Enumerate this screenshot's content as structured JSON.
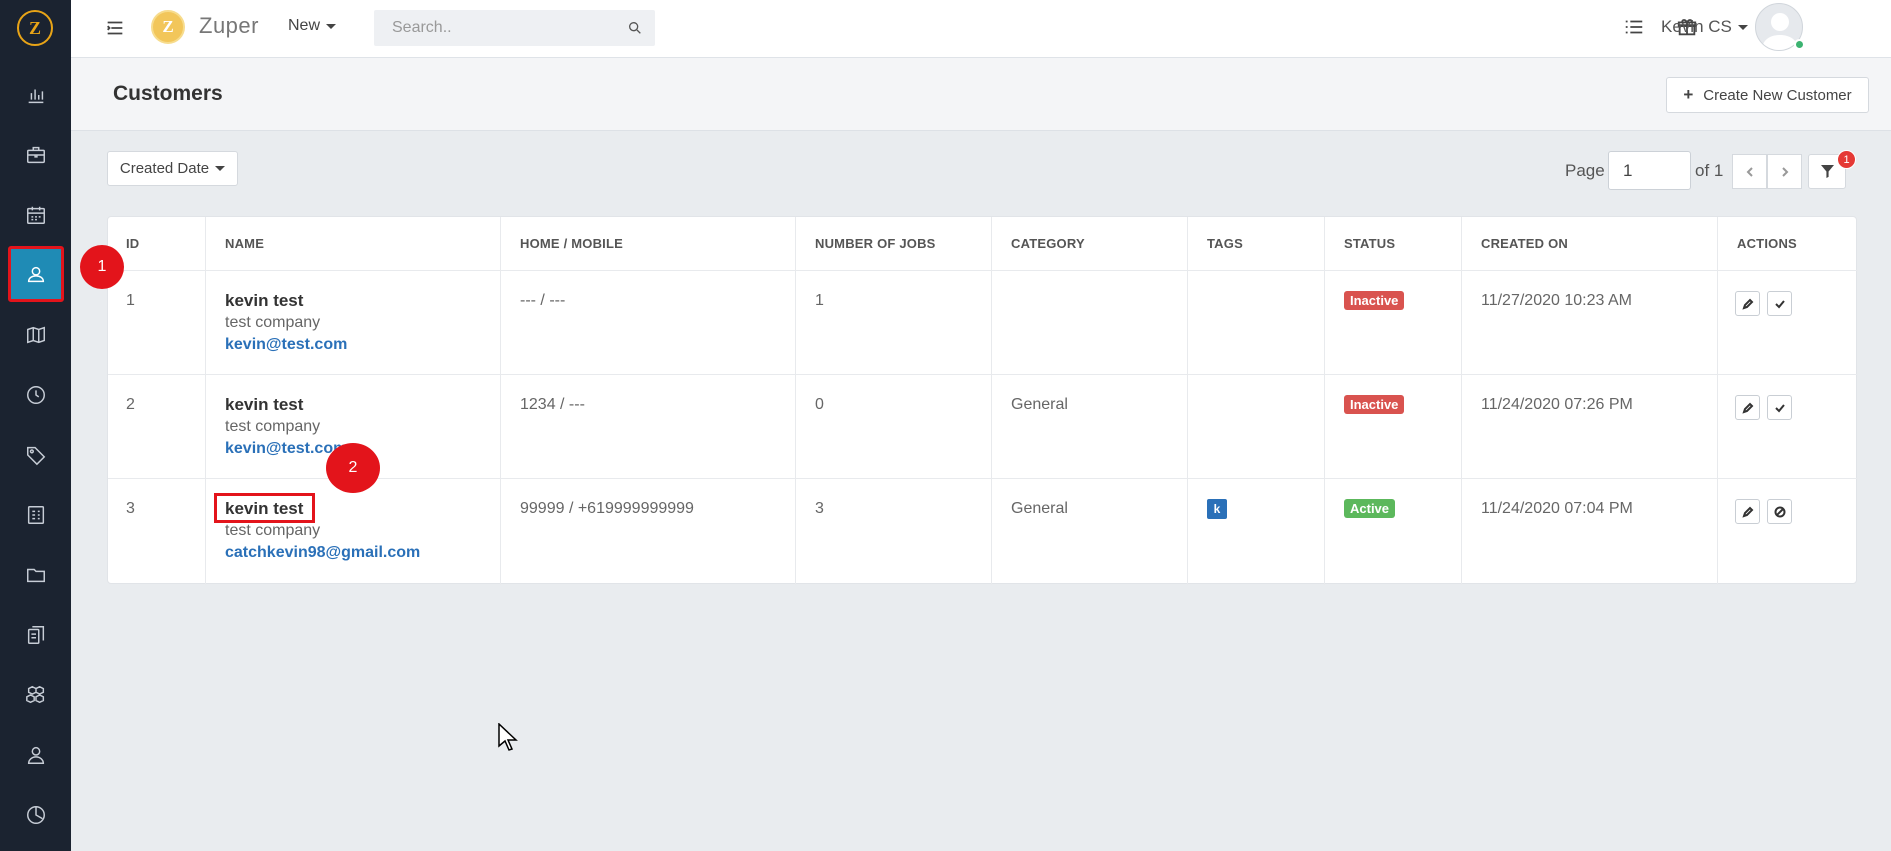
{
  "brand": {
    "logo_letter": "Z",
    "name": "Zuper"
  },
  "topbar": {
    "new_label": "New",
    "search_placeholder": "Search..",
    "user_name": "Kevin CS"
  },
  "sidebar": {
    "items": [
      {
        "icon": "dashboard-chart-icon"
      },
      {
        "icon": "briefcase-icon"
      },
      {
        "icon": "calendar-icon"
      },
      {
        "icon": "customers-icon",
        "active": true
      },
      {
        "icon": "map-icon"
      },
      {
        "icon": "clock-icon"
      },
      {
        "icon": "tag-icon"
      },
      {
        "icon": "invoice-icon"
      },
      {
        "icon": "folder-icon"
      },
      {
        "icon": "documents-icon"
      },
      {
        "icon": "boxes-icon"
      },
      {
        "icon": "user-icon"
      },
      {
        "icon": "reports-icon"
      }
    ]
  },
  "page": {
    "title": "Customers",
    "create_button": "Create New Customer",
    "sort_label": "Created Date",
    "pagination": {
      "label": "Page",
      "current": "1",
      "of_label": "of 1"
    },
    "filter_count": "1"
  },
  "table": {
    "headers": [
      "ID",
      "NAME",
      "HOME / MOBILE",
      "NUMBER OF JOBS",
      "CATEGORY",
      "TAGS",
      "STATUS",
      "CREATED ON",
      "ACTIONS"
    ],
    "rows": [
      {
        "id": "1",
        "name": "kevin test",
        "company": "test company",
        "email": "kevin@test.com",
        "phone": "--- / ---",
        "jobs": "1",
        "category": "",
        "tag": "",
        "status": "Inactive",
        "created": "11/27/2020 10:23 AM",
        "second_action": "check-icon"
      },
      {
        "id": "2",
        "name": "kevin test",
        "company": "test company",
        "email": "kevin@test.com",
        "phone": "1234 / ---",
        "jobs": "0",
        "category": "General",
        "tag": "",
        "status": "Inactive",
        "created": "11/24/2020 07:26 PM",
        "second_action": "check-icon"
      },
      {
        "id": "3",
        "name": "kevin test",
        "company": "test company",
        "email": "catchkevin98@gmail.com",
        "phone": "99999 / +619999999999",
        "jobs": "3",
        "category": "General",
        "tag": "k",
        "status": "Active",
        "created": "11/24/2020 07:04 PM",
        "second_action": "ban-icon"
      }
    ]
  },
  "annotations": {
    "marker_1": "1",
    "marker_2": "2"
  },
  "colors": {
    "sidebar_bg": "#1b2330",
    "active_item": "#1f8bb5",
    "annotation_red": "#e3141b",
    "inactive": "#d9534f",
    "active": "#5cb85c",
    "link": "#2a70b8"
  }
}
